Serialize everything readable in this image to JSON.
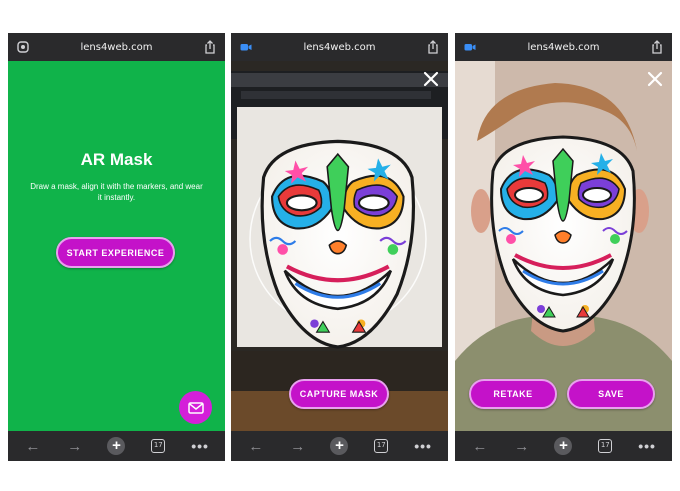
{
  "browser": {
    "url": "lens4web.com",
    "tab_count": "17",
    "nav": {
      "back": "←",
      "forward": "→",
      "new_tab": "+",
      "more": "•••"
    }
  },
  "screen1": {
    "title": "AR Mask",
    "description": "Draw a mask, align it with the markers, and wear it instantly.",
    "start_button": "START EXPERIENCE",
    "background_color": "#10b34a",
    "accent_color": "#c412c9",
    "fab_icon": "mail-icon"
  },
  "screen2": {
    "capture_button": "CAPTURE MASK",
    "close_icon": "close-icon",
    "lead_icon": "camera-icon"
  },
  "screen3": {
    "retake_button": "RETAKE",
    "save_button": "SAVE",
    "close_icon": "close-icon",
    "lead_icon": "camera-icon"
  }
}
